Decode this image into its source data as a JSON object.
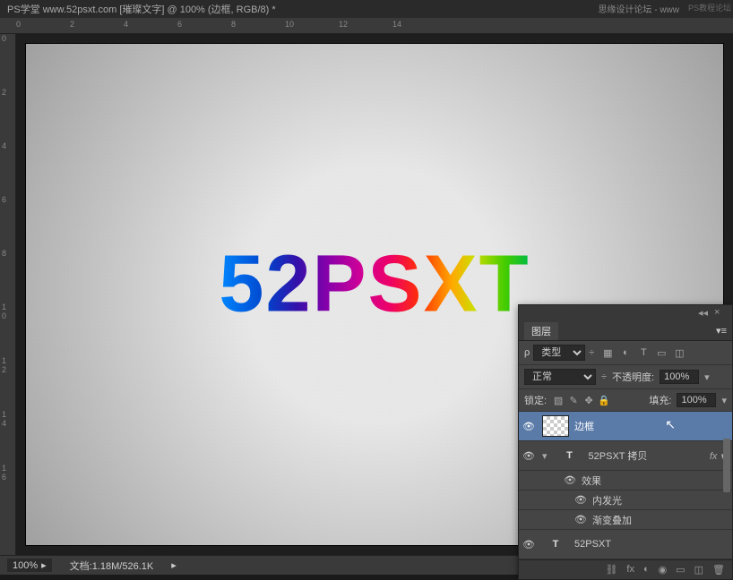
{
  "title": "PS学堂  www.52psxt.com [璀璨文字] @ 100% (边框, RGB/8) *",
  "watermark": "思缘设计论坛 - www",
  "watermark2": "PS教程论坛",
  "canvas_text": "52PSXT",
  "status": {
    "zoom": "100%",
    "doc_info": "文档:1.18M/526.1K"
  },
  "ruler_v": [
    "",
    "0",
    "",
    "2",
    "",
    "4",
    "",
    "6",
    "",
    "8",
    "1",
    "0",
    "1",
    "2",
    "1",
    "4",
    "1",
    "6"
  ],
  "ruler_h": [
    "0",
    "2",
    "4",
    "6",
    "8",
    "10",
    "12",
    "14"
  ],
  "layers_panel": {
    "tab": "图层",
    "filter_label": "类型",
    "search_icon": "ρ",
    "blend": {
      "mode": "正常",
      "opacity_label": "不透明度:",
      "opacity": "100%"
    },
    "lock": {
      "label": "锁定:",
      "fill_label": "填充:",
      "fill": "100%"
    },
    "layers": [
      {
        "type": "pixel",
        "name": "边框",
        "visible": true,
        "selected": true
      },
      {
        "type": "text",
        "name": "52PSXT 拷贝",
        "visible": true,
        "fx": true
      },
      {
        "type": "text",
        "name": "52PSXT",
        "visible": true
      }
    ],
    "effects": {
      "label": "效果",
      "items": [
        "内发光",
        "渐变叠加"
      ]
    },
    "footer_icons": {
      "link": "⛓",
      "fx": "fx",
      "mask": "◐",
      "adjust": "◑",
      "group": "▭",
      "new": "◫",
      "delete": "🗑"
    }
  }
}
